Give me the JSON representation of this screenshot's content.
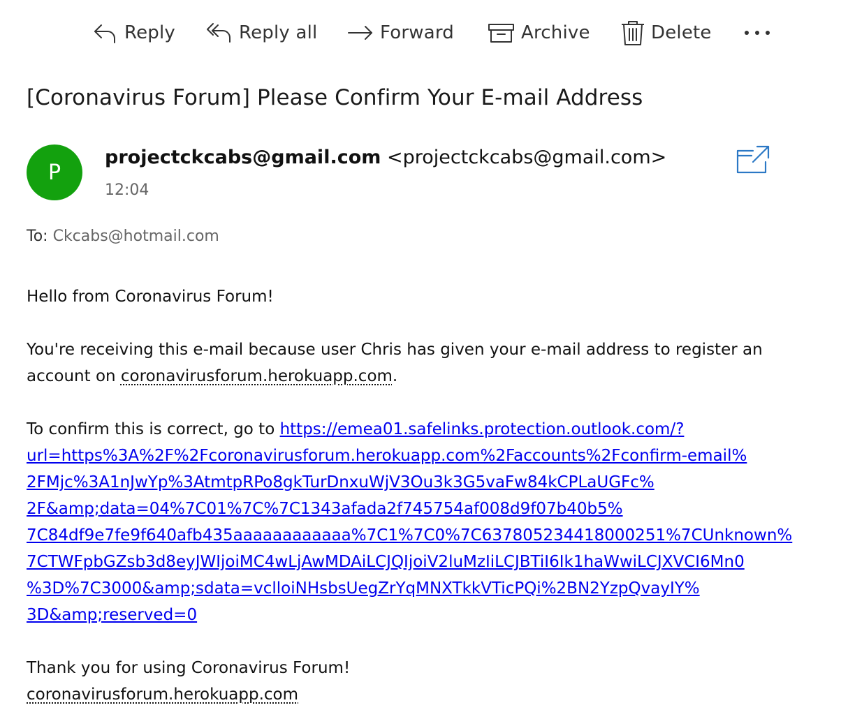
{
  "toolbar": {
    "reply": "Reply",
    "reply_all": "Reply all",
    "forward": "Forward",
    "archive": "Archive",
    "delete": "Delete",
    "more": "..."
  },
  "message": {
    "subject": "[Coronavirus Forum] Please Confirm Your E-mail Address",
    "avatar_initial": "P",
    "avatar_color": "#13a10e",
    "sender_name": "projectckcabs@gmail.com",
    "sender_email": "<projectckcabs@gmail.com>",
    "time": "12:04",
    "to_label": "To:",
    "to_address": "Ckcabs@hotmail.com"
  },
  "body": {
    "greeting": "Hello from Coronavirus Forum!",
    "para1_a": "You're receiving this e-mail because user Chris has given your e-mail address to register an account on ",
    "para1_link": "coronavirusforum.herokuapp.com",
    "para1_b": ".",
    "para2_a": "To confirm this is correct, go to ",
    "confirm_link_lines": [
      "https://emea01.safelinks.protection.outlook.com/?",
      "url=https%3A%2F%2Fcoronavirusforum.herokuapp.com%2Faccounts%2Fconfirm-email%",
      "2FMjc%3A1nJwYp%3AtmtpRPo8gkTurDnxuWjV3Ou3k3G5vaFw84kCPLaUGFc%",
      "2F&amp;data=04%7C01%7C%7C1343afada2f745754af008d9f07b40b5%",
      "7C84df9e7fe9f640afb435aaaaaaaaaaaa%7C1%7C0%7C637805234418000251%7CUnknown%",
      "7CTWFpbGZsb3d8eyJWIjoiMC4wLjAwMDAiLCJQIjoiV2luMzIiLCJBTiI6Ik1haWwiLCJXVCI6Mn0",
      "%3D%7C3000&amp;sdata=vclloiNHsbsUegZrYqMNXTkkVTicPQi%2BN2YzpQvayIY%",
      "3D&amp;reserved=0"
    ],
    "thanks": "Thank you for using Coronavirus Forum!",
    "footer_link": "coronavirusforum.herokuapp.com"
  },
  "icons": {
    "reply": "reply-arrow-icon",
    "reply_all": "reply-all-arrow-icon",
    "forward": "forward-arrow-icon",
    "archive": "archive-box-icon",
    "delete": "trash-can-icon",
    "more": "more-dots-icon",
    "popout": "open-in-new-window-icon"
  }
}
